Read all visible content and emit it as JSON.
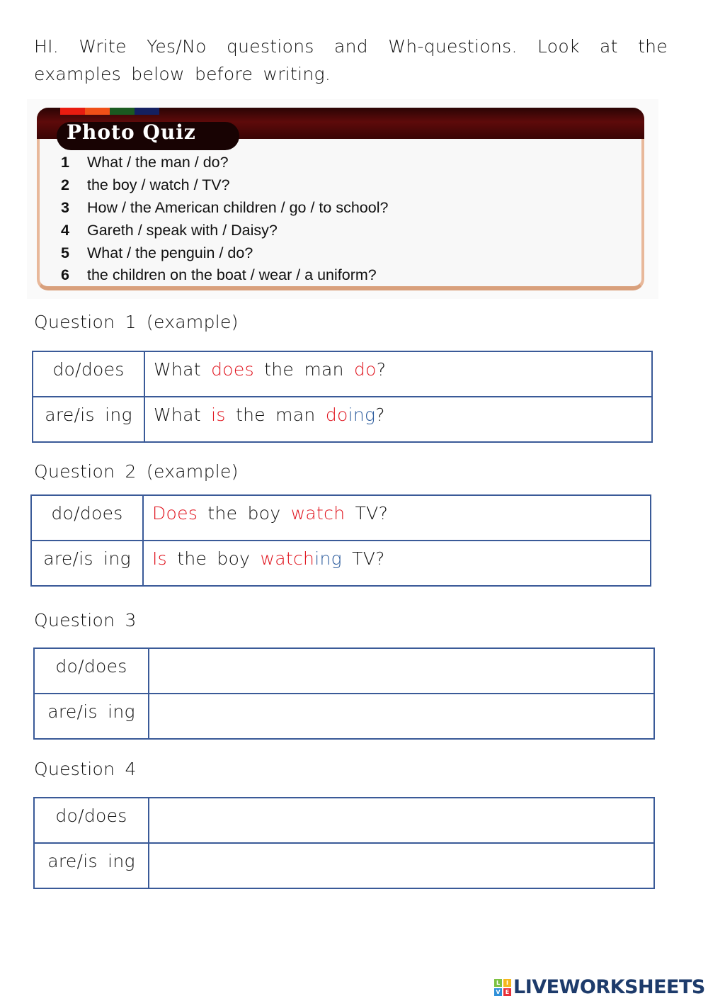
{
  "instructions": "HI. Write Yes/No questions and Wh-questions. Look at the examples below before writing.",
  "photo_quiz": {
    "title": "Photo Quiz",
    "stripe_colors": [
      "#e81c10",
      "#f05018",
      "#1a5a20",
      "#142060"
    ],
    "items": [
      {
        "num": "1",
        "text": "What / the man / do?"
      },
      {
        "num": "2",
        "text": "the boy / watch / TV?"
      },
      {
        "num": "3",
        "text": "How / the American children / go / to school?"
      },
      {
        "num": "4",
        "text": "Gareth / speak with / Daisy?"
      },
      {
        "num": "5",
        "text": "What / the penguin / do?"
      },
      {
        "num": "6",
        "text": "the children on the boat / wear / a uniform?"
      }
    ]
  },
  "questions": [
    {
      "label": "Question 1 (example)",
      "rows": [
        {
          "key": "do/does",
          "segments": [
            {
              "t": "What ",
              "c": ""
            },
            {
              "t": "does",
              "c": "red"
            },
            {
              "t": " the man ",
              "c": ""
            },
            {
              "t": "do",
              "c": "red"
            },
            {
              "t": "?",
              "c": ""
            }
          ]
        },
        {
          "key": "are/is ing",
          "segments": [
            {
              "t": "What ",
              "c": ""
            },
            {
              "t": "is",
              "c": "red"
            },
            {
              "t": " the man ",
              "c": ""
            },
            {
              "t": "do",
              "c": "red"
            },
            {
              "t": "ing",
              "c": "blue"
            },
            {
              "t": "?",
              "c": ""
            }
          ]
        }
      ]
    },
    {
      "label": "Question 2 (example)",
      "rows": [
        {
          "key": "do/does",
          "segments": [
            {
              "t": "Does",
              "c": "red"
            },
            {
              "t": " the boy ",
              "c": ""
            },
            {
              "t": "watch",
              "c": "red"
            },
            {
              "t": " TV?",
              "c": ""
            }
          ]
        },
        {
          "key": "are/is ing",
          "segments": [
            {
              "t": "Is",
              "c": "red"
            },
            {
              "t": " the boy ",
              "c": ""
            },
            {
              "t": "watch",
              "c": "red"
            },
            {
              "t": "ing",
              "c": "blue"
            },
            {
              "t": " TV?",
              "c": ""
            }
          ]
        }
      ]
    },
    {
      "label": "Question 3",
      "rows": [
        {
          "key": "do/does",
          "answer": ""
        },
        {
          "key": "are/is ing",
          "answer": ""
        }
      ]
    },
    {
      "label": "Question 4",
      "rows": [
        {
          "key": "do/does",
          "answer": ""
        },
        {
          "key": "are/is ing",
          "answer": ""
        }
      ]
    }
  ],
  "colors": {
    "highlight_red": "#e0141e",
    "highlight_blue": "#2a5a9c",
    "table_border": "#3a5a98"
  },
  "logo": {
    "tiles": [
      {
        "letter": "L",
        "color": "#7cc242"
      },
      {
        "letter": "I",
        "color": "#f5b81c"
      },
      {
        "letter": "V",
        "color": "#2e8fd8"
      },
      {
        "letter": "E",
        "color": "#e8313a"
      }
    ],
    "text": "LIVEWORKSHEETS"
  }
}
